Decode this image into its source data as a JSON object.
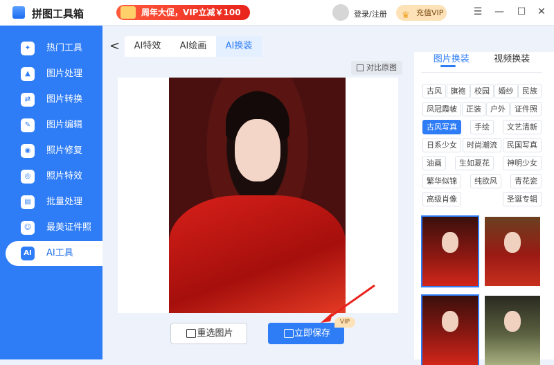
{
  "app": {
    "title": "拼图工具箱",
    "promo": "周年大促，VIP立减￥100",
    "login": "登录/注册",
    "vip": "充值VIP"
  },
  "window": {
    "menu": "☰",
    "minimize": "—",
    "maximize": "☐",
    "close": "✕"
  },
  "sidebar": {
    "items": [
      {
        "label": "热门工具",
        "icon": "hot-tools-icon",
        "glyph": "✦"
      },
      {
        "label": "图片处理",
        "icon": "image-process-icon",
        "glyph": "▲"
      },
      {
        "label": "图片转换",
        "icon": "image-convert-icon",
        "glyph": "⇄"
      },
      {
        "label": "图片编辑",
        "icon": "image-edit-icon",
        "glyph": "✎"
      },
      {
        "label": "照片修复",
        "icon": "photo-repair-icon",
        "glyph": "◉"
      },
      {
        "label": "照片特效",
        "icon": "photo-effect-icon",
        "glyph": "◎"
      },
      {
        "label": "批量处理",
        "icon": "batch-icon",
        "glyph": "▤"
      },
      {
        "label": "最美证件照",
        "icon": "id-photo-icon",
        "glyph": "☺"
      },
      {
        "label": "AI工具",
        "icon": "ai-icon",
        "glyph": "AI"
      }
    ],
    "active": 8
  },
  "tabs": {
    "back": "<",
    "items": [
      "AI特效",
      "AI绘画",
      "AI换装"
    ],
    "active": 2
  },
  "canvas": {
    "compare": "对比原图"
  },
  "actions": {
    "reselect": "重选图片",
    "save": "立即保存",
    "vip_badge": "VIP"
  },
  "right": {
    "tabs": [
      "图片换装",
      "视频换装"
    ],
    "active_tab": 0,
    "tag_rows": [
      [
        "古风",
        "旗袍",
        "校园",
        "婚纱",
        "民族"
      ],
      [
        "凤冠霞帔",
        "正装",
        "户外",
        "证件照"
      ],
      [
        "古风写真",
        "手绘",
        "文艺清新"
      ],
      [
        "日系少女",
        "时尚潮流",
        "民国写真"
      ],
      [
        "油画",
        "生如夏花",
        "神明少女"
      ],
      [
        "繁华似锦",
        "纯欲风",
        "青花瓷"
      ],
      [
        "高级肖像",
        "圣诞专辑"
      ]
    ],
    "active_tag": "古风写真"
  },
  "colors": {
    "accent": "#2e7cf6",
    "promo": "#e8231b",
    "vip": "#fde2b8"
  }
}
